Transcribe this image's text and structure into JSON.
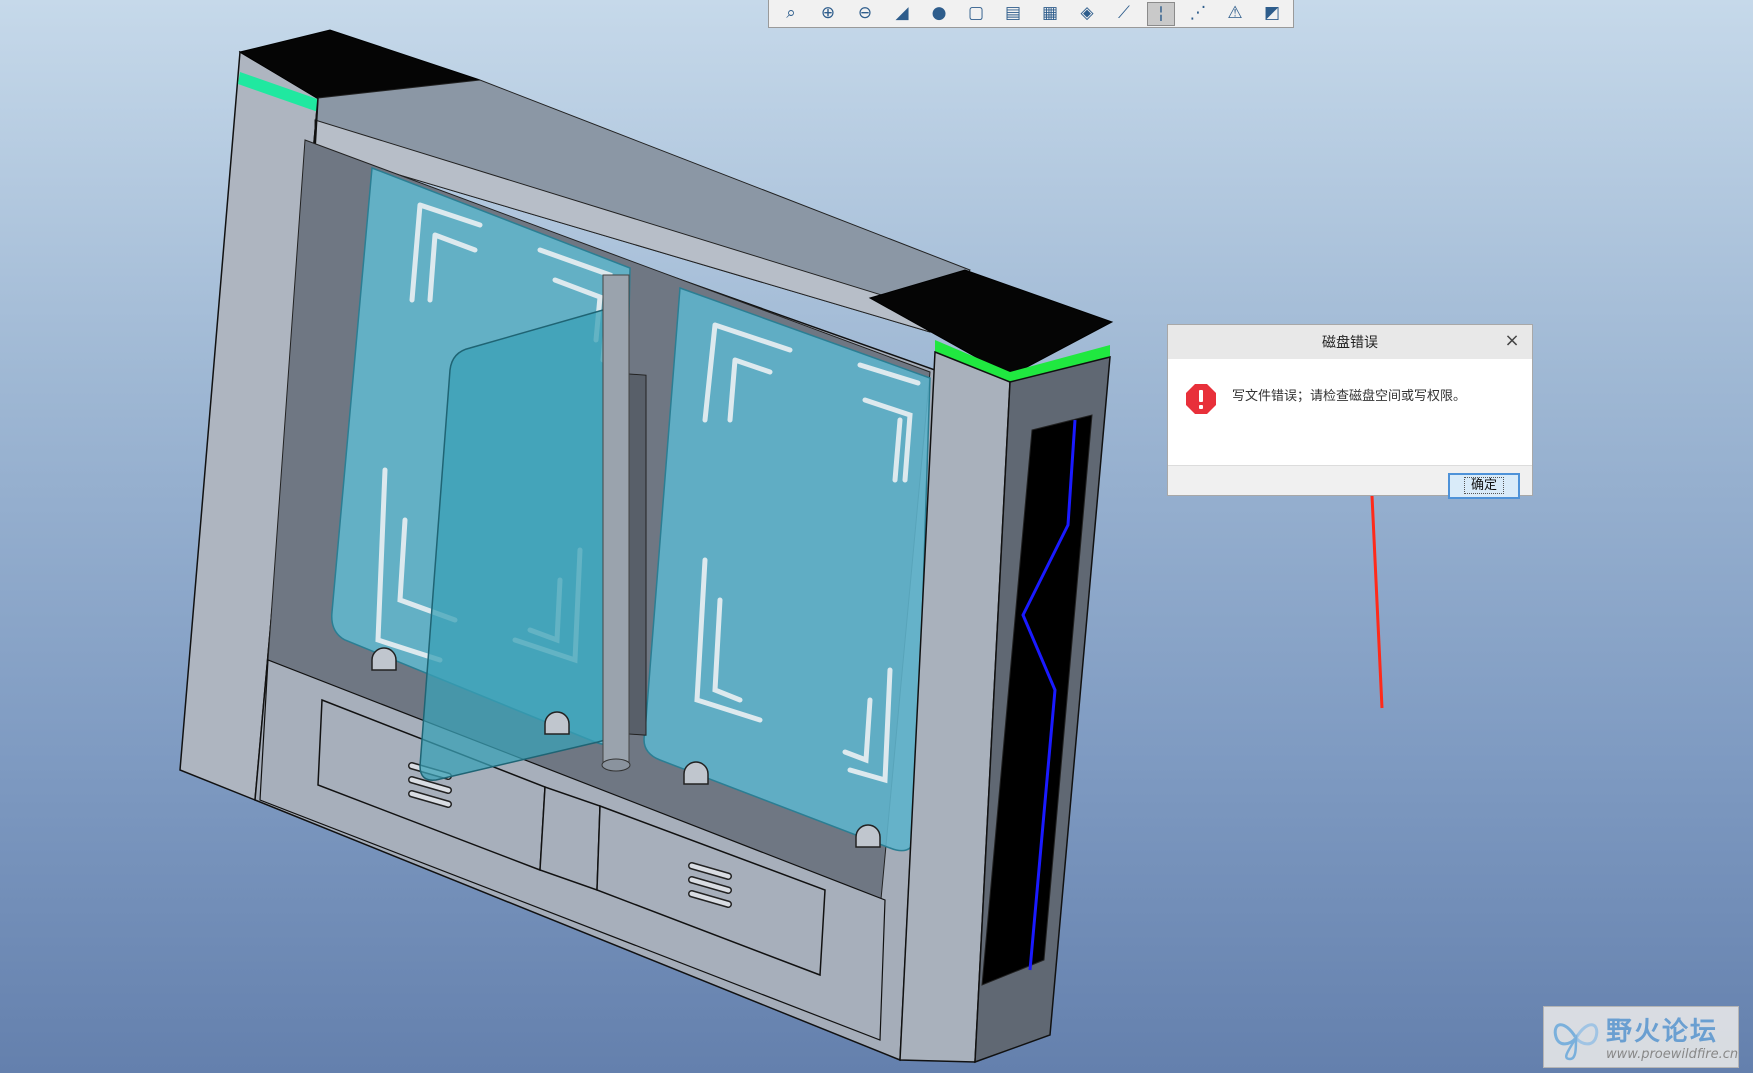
{
  "toolbar": {
    "buttons": [
      {
        "icon": "zoom-fit-icon",
        "glyph": "⌕"
      },
      {
        "icon": "zoom-in-icon",
        "glyph": "⊕"
      },
      {
        "icon": "zoom-out-icon",
        "glyph": "⊖"
      },
      {
        "icon": "repaint-icon",
        "glyph": "◢"
      },
      {
        "icon": "shading-icon",
        "glyph": "●"
      },
      {
        "icon": "view-orient-icon",
        "glyph": "▢"
      },
      {
        "icon": "saved-views-icon",
        "glyph": "▤"
      },
      {
        "icon": "layers-icon",
        "glyph": "▦"
      },
      {
        "icon": "appearance-icon",
        "glyph": "◈"
      },
      {
        "icon": "datum-planes-icon",
        "glyph": "⟋"
      },
      {
        "icon": "datum-axes-icon",
        "glyph": "¦"
      },
      {
        "icon": "datum-points-icon",
        "glyph": "⋰"
      },
      {
        "icon": "csys-icon",
        "glyph": "⚠"
      },
      {
        "icon": "annotation-icon",
        "glyph": "◩"
      }
    ],
    "active_index": 10
  },
  "dialog": {
    "title": "磁盘错误",
    "close_glyph": "×",
    "message": "写文件错误；请检查磁盘空间或写权限。",
    "ok_label": "确定",
    "icon": "error-icon"
  },
  "watermark": {
    "name": "野火论坛",
    "url": "www.proewildfire.cn",
    "logo_icon": "butterfly-logo-icon"
  },
  "colors": {
    "accent_green": "#20e860",
    "glass": "#5fb4cc",
    "frame": "#9aa4b2",
    "arrow": "#ff2a1a",
    "blue_line": "#1a1aff"
  }
}
